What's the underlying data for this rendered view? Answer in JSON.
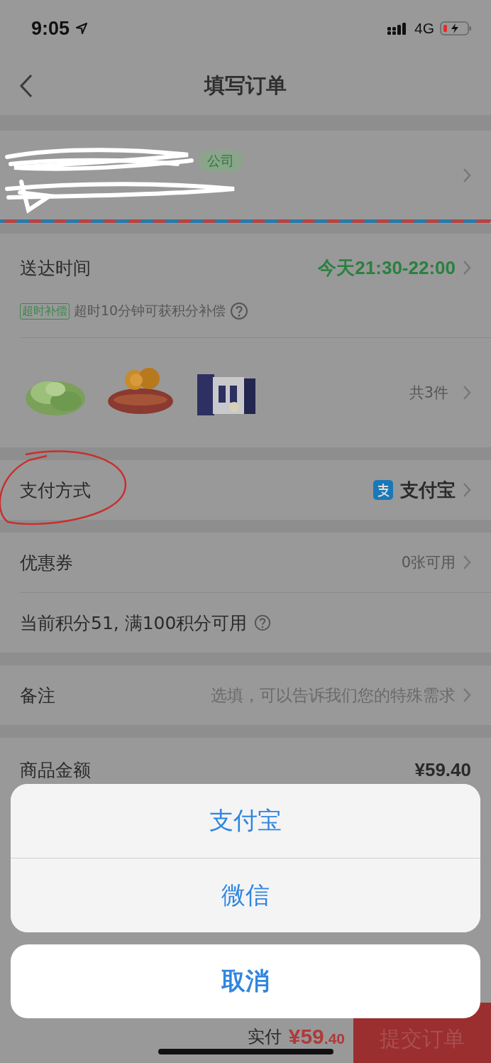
{
  "status_bar": {
    "time": "9:05",
    "network": "4G"
  },
  "nav": {
    "title": "填写订单"
  },
  "address": {
    "tag": "公司"
  },
  "delivery": {
    "label": "送达时间",
    "value": "今天21:30-22:00",
    "badge": "超时补偿",
    "note": "超时10分钟可获积分补偿"
  },
  "products": {
    "count": "共3件"
  },
  "payment": {
    "label": "支付方式",
    "value": "支付宝"
  },
  "coupon": {
    "label": "优惠券",
    "value": "0张可用"
  },
  "points": {
    "text": "当前积分51, 满100积分可用"
  },
  "remark": {
    "label": "备注",
    "placeholder": "选填，可以告诉我们您的特殊需求"
  },
  "amount": {
    "label": "商品金额",
    "value": "¥59.40"
  },
  "action_sheet": {
    "options": [
      "支付宝",
      "微信"
    ],
    "cancel": "取消"
  },
  "bottom_bar": {
    "label": "实付",
    "price_main": "¥59",
    "price_fraction": ".40",
    "submit": "提交订单"
  }
}
